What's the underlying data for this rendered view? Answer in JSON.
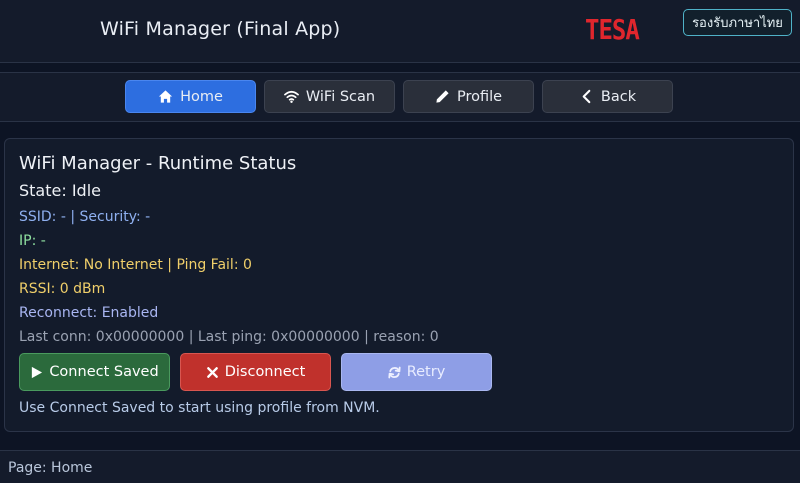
{
  "header": {
    "title": "WiFi Manager (Final App)",
    "logo_text": "TESA",
    "lang_button": "รองรับภาษาไทย"
  },
  "nav": {
    "items": [
      {
        "label": "Home",
        "icon": "home-icon",
        "active": true
      },
      {
        "label": "WiFi Scan",
        "icon": "wifi-icon",
        "active": false
      },
      {
        "label": "Profile",
        "icon": "pencil-icon",
        "active": false
      },
      {
        "label": "Back",
        "icon": "chevron-left-icon",
        "active": false
      }
    ]
  },
  "status": {
    "title": "WiFi Manager - Runtime Status",
    "state": "State: Idle",
    "ssid_line": "SSID: - | Security: -",
    "ip_line": "IP: -",
    "internet_line": "Internet: No Internet | Ping Fail: 0",
    "rssi_line": "RSSI: 0 dBm",
    "reconnect_line": "Reconnect: Enabled",
    "last_line": "Last conn: 0x00000000 | Last ping: 0x00000000 | reason: 0",
    "hint": "Use Connect Saved to start using profile from NVM."
  },
  "actions": {
    "connect_label": "Connect Saved",
    "disconnect_label": "Disconnect",
    "retry_label": "Retry"
  },
  "footer": {
    "page_label": "Page: Home"
  },
  "colors": {
    "background": "#0d1424",
    "accent_active": "#2d6ee0",
    "connect": "#2b6a3c",
    "disconnect": "#c0312c",
    "retry": "#8e9ee6",
    "logo": "#e0262d"
  }
}
